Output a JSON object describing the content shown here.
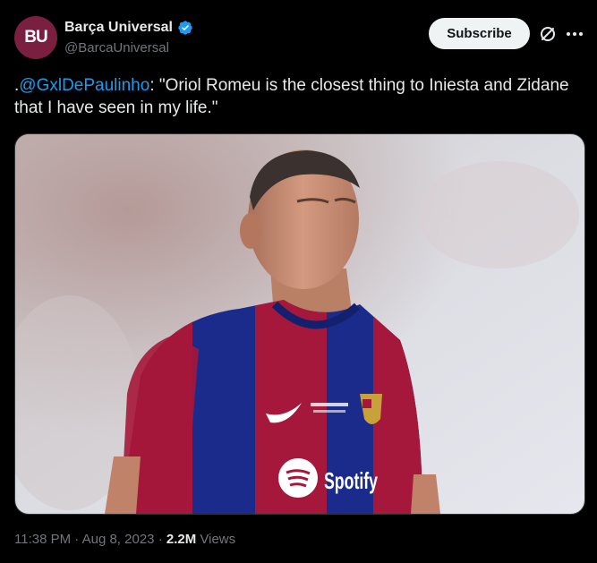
{
  "author": {
    "avatar_text": "BU",
    "display_name": "Barça Universal",
    "handle": "@BarcaUniversal"
  },
  "actions": {
    "subscribe_label": "Subscribe",
    "grok_icon": "grok-icon",
    "more_icon": "more-icon"
  },
  "tweet": {
    "prefix": ".",
    "mention": "@GxlDePaulinho",
    "body": ": \"Oriol Romeu is the closest thing to Iniesta and Zidane that I have seen in my life.\""
  },
  "media": {
    "shirt_sponsor": "Spotify"
  },
  "meta": {
    "time": "11:38 PM",
    "date": "Aug 8, 2023",
    "views_count": "2.2M",
    "views_label": "Views"
  },
  "colors": {
    "accent": "#1d9bf0",
    "background": "#000000",
    "avatar": "#7a1f3f"
  }
}
